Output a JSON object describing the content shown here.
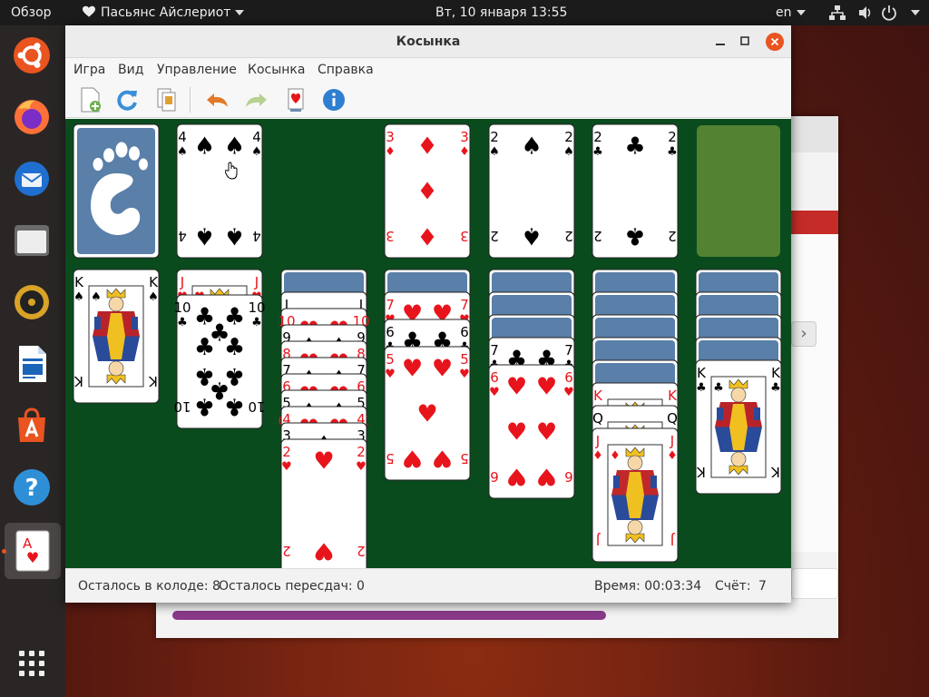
{
  "topbar": {
    "overview": "Обзор",
    "app_name": "Пасьянс Айслериот",
    "clock": "Вт, 10 января  13:55",
    "lang": "en"
  },
  "dock": {
    "items": [
      {
        "name": "ubuntu-icon"
      },
      {
        "name": "firefox-icon"
      },
      {
        "name": "thunderbird-icon"
      },
      {
        "name": "files-icon"
      },
      {
        "name": "rhythmbox-icon"
      },
      {
        "name": "writer-icon"
      },
      {
        "name": "software-icon"
      },
      {
        "name": "help-icon"
      },
      {
        "name": "solitaire-icon"
      },
      {
        "name": "show-apps-icon"
      }
    ]
  },
  "window": {
    "title": "Косынка",
    "menu": [
      "Игра",
      "Вид",
      "Управление",
      "Косынка",
      "Справка"
    ],
    "toolbar": [
      "new-game-icon",
      "restart-icon",
      "select-game-icon",
      "undo-icon",
      "redo-icon",
      "hint-icon",
      "info-icon"
    ]
  },
  "game": {
    "stock": "back",
    "waste": [
      "4♠"
    ],
    "foundations": [
      "3♦",
      "2♠",
      "2♣",
      "empty"
    ],
    "tableau": [
      {
        "backs": 0,
        "up": [
          "K♠"
        ]
      },
      {
        "backs": 0,
        "up": [
          "J♥",
          "10♣"
        ]
      },
      {
        "backs": 1,
        "up": [
          "J♠",
          "10♥",
          "9♠",
          "8♥",
          "7♠",
          "6♥",
          "5♠",
          "4♥",
          "3♠",
          "2♥"
        ]
      },
      {
        "backs": 1,
        "up": [
          "7♥",
          "6♣",
          "5♥"
        ]
      },
      {
        "backs": 3,
        "up": [
          "7♣",
          "6♥"
        ]
      },
      {
        "backs": 5,
        "up": [
          "K♥",
          "Q♣",
          "J♦"
        ]
      },
      {
        "backs": 4,
        "up": [
          "K♣"
        ]
      }
    ]
  },
  "status": {
    "deck_left": "Осталось в колоде: 8",
    "redeals_left": "Осталось пересдач: 0",
    "time": "Время: 00:03:34",
    "score_label": "Счёт:",
    "score": "7"
  },
  "colors": {
    "felt": "#0a4b1d",
    "card_back": "#5a7fa8",
    "red": "#e8141c",
    "empty_slot": "#538232"
  }
}
